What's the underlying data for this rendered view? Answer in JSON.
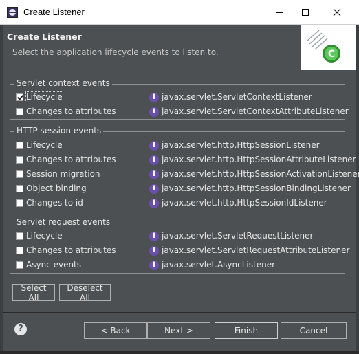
{
  "window": {
    "title": "Create Listener"
  },
  "header": {
    "title": "Create Listener",
    "subtitle": "Select the application lifecycle events to listen to."
  },
  "groups": [
    {
      "title": "Servlet context events",
      "items": [
        {
          "label": "Lifecycle",
          "class": "javax.servlet.ServletContextListener",
          "checked": true
        },
        {
          "label": "Changes to attributes",
          "class": "javax.servlet.ServletContextAttributeListener",
          "checked": false
        }
      ]
    },
    {
      "title": "HTTP session events",
      "items": [
        {
          "label": "Lifecycle",
          "class": "javax.servlet.http.HttpSessionListener",
          "checked": false
        },
        {
          "label": "Changes to attributes",
          "class": "javax.servlet.http.HttpSessionAttributeListener",
          "checked": false
        },
        {
          "label": "Session migration",
          "class": "javax.servlet.http.HttpSessionActivationListener",
          "checked": false
        },
        {
          "label": "Object binding",
          "class": "javax.servlet.http.HttpSessionBindingListener",
          "checked": false
        },
        {
          "label": "Changes to id",
          "class": "javax.servlet.http.HttpSessionIdListener",
          "checked": false
        }
      ]
    },
    {
      "title": "Servlet request events",
      "items": [
        {
          "label": "Lifecycle",
          "class": "javax.servlet.ServletRequestListener",
          "checked": false
        },
        {
          "label": "Changes to attributes",
          "class": "javax.servlet.ServletRequestAttributeListener",
          "checked": false
        },
        {
          "label": "Async events",
          "class": "javax.servlet.AsyncListener",
          "checked": false
        }
      ]
    }
  ],
  "interface_icon_glyph": "I",
  "actions": {
    "select_all": "Select All",
    "deselect_all": "Deselect All"
  },
  "footer": {
    "help": "?",
    "back": "< Back",
    "next": "Next >",
    "finish": "Finish",
    "cancel": "Cancel"
  }
}
